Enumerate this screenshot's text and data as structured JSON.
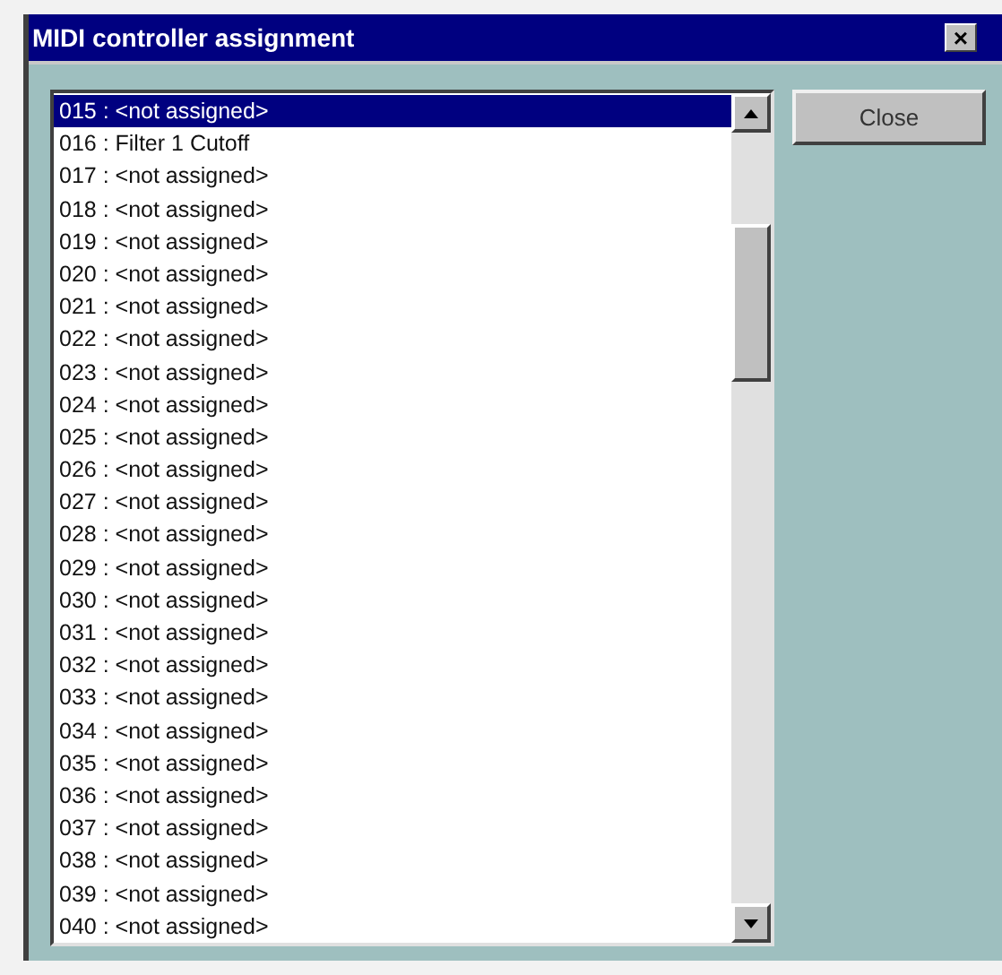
{
  "window": {
    "title": "MIDI controller assignment",
    "close_glyph": "×"
  },
  "list": {
    "items": [
      {
        "text": "015 : <not assigned>",
        "selected": true
      },
      {
        "text": "016 : Filter 1 Cutoff",
        "selected": false
      },
      {
        "text": "017 : <not assigned>",
        "selected": false
      },
      {
        "text": "018 : <not assigned>",
        "selected": false
      },
      {
        "text": "019 : <not assigned>",
        "selected": false
      },
      {
        "text": "020 : <not assigned>",
        "selected": false
      },
      {
        "text": "021 : <not assigned>",
        "selected": false
      },
      {
        "text": "022 : <not assigned>",
        "selected": false
      },
      {
        "text": "023 : <not assigned>",
        "selected": false
      },
      {
        "text": "024 : <not assigned>",
        "selected": false
      },
      {
        "text": "025 : <not assigned>",
        "selected": false
      },
      {
        "text": "026 : <not assigned>",
        "selected": false
      },
      {
        "text": "027 : <not assigned>",
        "selected": false
      },
      {
        "text": "028 : <not assigned>",
        "selected": false
      },
      {
        "text": "029 : <not assigned>",
        "selected": false
      },
      {
        "text": "030 : <not assigned>",
        "selected": false
      },
      {
        "text": "031 : <not assigned>",
        "selected": false
      },
      {
        "text": "032 : <not assigned>",
        "selected": false
      },
      {
        "text": "033 : <not assigned>",
        "selected": false
      },
      {
        "text": "034 : <not assigned>",
        "selected": false
      },
      {
        "text": "035 : <not assigned>",
        "selected": false
      },
      {
        "text": "036 : <not assigned>",
        "selected": false
      },
      {
        "text": "037 : <not assigned>",
        "selected": false
      },
      {
        "text": "038 : <not assigned>",
        "selected": false
      },
      {
        "text": "039 : <not assigned>",
        "selected": false
      },
      {
        "text": "040 : <not assigned>",
        "selected": false
      }
    ]
  },
  "buttons": [
    {
      "label": "Close"
    }
  ]
}
